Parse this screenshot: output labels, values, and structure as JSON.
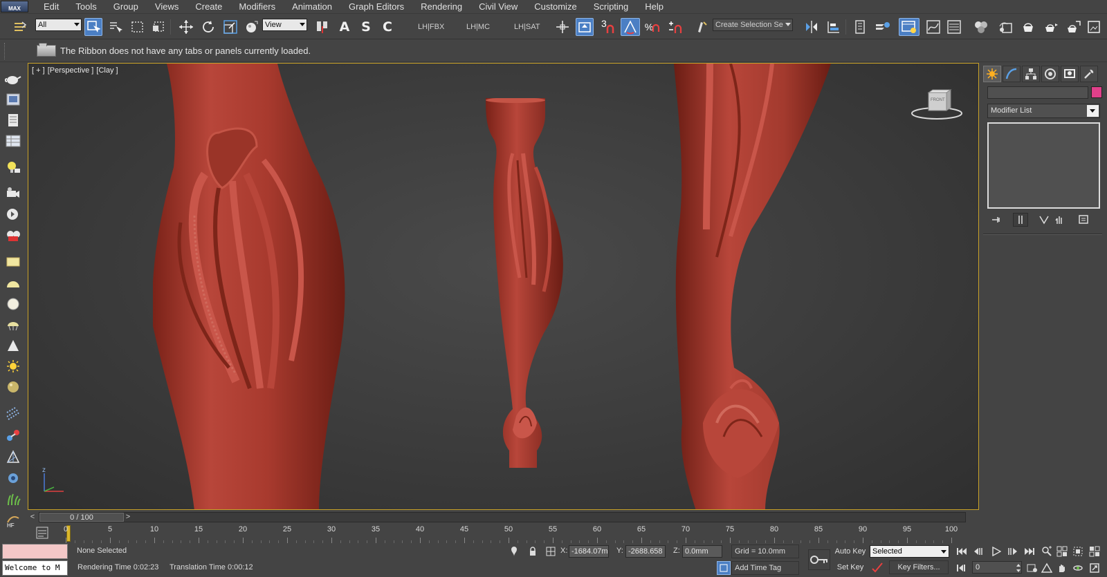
{
  "app": {
    "logo_text": "MAX"
  },
  "menu": [
    "Edit",
    "Tools",
    "Group",
    "Views",
    "Create",
    "Modifiers",
    "Animation",
    "Graph Editors",
    "Rendering",
    "Civil View",
    "Customize",
    "Scripting",
    "Help"
  ],
  "toolbar": {
    "selection_filter": "All",
    "ref_coord": "View",
    "letters": [
      "A",
      "S",
      "C"
    ],
    "lh_labels": [
      "LH|FBX",
      "LH|MC",
      "LH|SAT"
    ],
    "snap_value": "3",
    "named_selection_placeholder": "Create Selection Se"
  },
  "ribbon": {
    "message": "The Ribbon does not have any tabs or panels currently loaded."
  },
  "viewport": {
    "labels": [
      "[ + ]",
      "[Perspective ]",
      "[Clay ]"
    ],
    "viewcube_label": "FRONT",
    "axis_z": "z",
    "object_color": "#a8392d"
  },
  "command_panel": {
    "modifier_list": "Modifier List",
    "object_color": "#e0408a"
  },
  "time_slider": {
    "position": "0 / 100",
    "prev": "<",
    "next": ">"
  },
  "track": {
    "ticks": [
      "0",
      "5",
      "10",
      "15",
      "20",
      "25",
      "30",
      "35",
      "40",
      "45",
      "50",
      "55",
      "60",
      "65",
      "70",
      "75",
      "80",
      "85",
      "90",
      "95",
      "100"
    ]
  },
  "status": {
    "listener_text": "Welcome to M",
    "selection": "None Selected",
    "rendering_time": "Rendering Time  0:02:23",
    "translation_time": "Translation Time  0:00:12",
    "x_label": "X:",
    "x_value": "-1684.07m",
    "y_label": "Y:",
    "y_value": "-2688.658",
    "z_label": "Z:",
    "z_value": "0.0mm",
    "grid": "Grid = 10.0mm",
    "add_time_tag": "Add Time Tag",
    "auto_key": "Auto Key",
    "set_key": "Set Key",
    "selected": "Selected",
    "key_filters": "Key Filters...",
    "frame": "0"
  }
}
